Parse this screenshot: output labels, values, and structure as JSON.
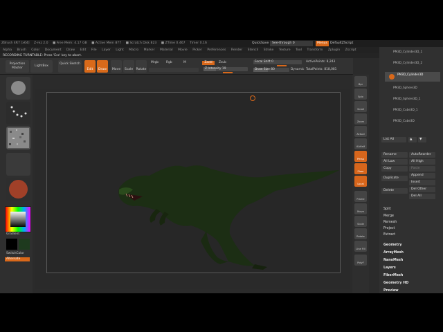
{
  "titlebar": {
    "items": [
      "ZBrush 4R7 [x64]",
      "Z-rez 2.0",
      "■ Free Mem: 4.17 GB",
      "■ Active Mem 877",
      "■ Scratch Disk 823",
      "■ ZTime 0.467",
      "Timer 0.16"
    ],
    "quicksave": "QuickSave",
    "seethrough": "See-through",
    "seethrough_value": "0",
    "menus": "Menus",
    "defaultscript": "DefaultZScript"
  },
  "menubar": {
    "items": [
      "Alpha",
      "Brush",
      "Color",
      "Document",
      "Draw",
      "Edit",
      "File",
      "Layer",
      "Light",
      "Macro",
      "Marker",
      "Material",
      "Movie",
      "Picker",
      "Preferences",
      "Render",
      "Stencil",
      "Stroke",
      "Texture",
      "Tool",
      "Transform",
      "Zplugin",
      "Zscript"
    ]
  },
  "notice": "RECORDING TURNTABLE: Press 'Esc' key to abort.",
  "shelf": {
    "projection_master": "Projection Master",
    "lightbox": "LightBox",
    "quick_sketch": "Quick Sketch",
    "edit": "Edit",
    "draw": "Draw",
    "move": "Move",
    "scale": "Scale",
    "rotate": "Rotate",
    "mrgb": "Mrgb",
    "rgb": "Rgb",
    "m": "M",
    "zadd": "Zadd",
    "zsub": "Zsub",
    "z_intensity": "Z Intensity 19",
    "focal_shift": "Focal Shift 0",
    "draw_size": "Draw Size 80",
    "dynamic": "Dynamic",
    "active_points": "ActivePoints: 8,243",
    "total_points": "TotalPoints: 818,081"
  },
  "left": {
    "gradient": "Gradient",
    "switch_color": "SwitchColor",
    "alternate": "Alternate"
  },
  "right_tools": [
    "Bpr",
    "Spix",
    "Scroll",
    "Zoom",
    "Actual",
    "AAHalf",
    "Persp",
    "Floor",
    "Local",
    "Frame",
    "Move",
    "Scale",
    "Rotate",
    "Line Fill",
    "PolyF"
  ],
  "subtools": [
    "PM3D_Cylinder3D_1",
    "PM3D_Cylinder3D_2",
    "PM3D_Cylinder3D",
    "PM3D_Sphere3D",
    "PM3D_Sphere3D_1",
    "PM3D_Cube3D_1",
    "PM3D_Cube3D"
  ],
  "subtool_panel": {
    "list_all": "List All",
    "rename": "Rename",
    "autoreorder": "AutoReorder",
    "all_low": "All Low",
    "all_high": "All High",
    "copy": "Copy",
    "paste": "Paste",
    "append": "Append",
    "duplicate": "Duplicate",
    "insert": "Insert",
    "delete": "Delete",
    "del_other": "Del Other",
    "del_all": "Del All",
    "split": "Split",
    "merge": "Merge",
    "remesh": "Remesh",
    "project": "Project",
    "extract": "Extract"
  },
  "sections": [
    "Geometry",
    "ArrayMesh",
    "NanoMesh",
    "Layers",
    "FiberMesh",
    "Geometry HD",
    "Preview"
  ],
  "colors": {
    "accent": "#d9681a",
    "panel": "#303030",
    "canvas": "#272727"
  }
}
